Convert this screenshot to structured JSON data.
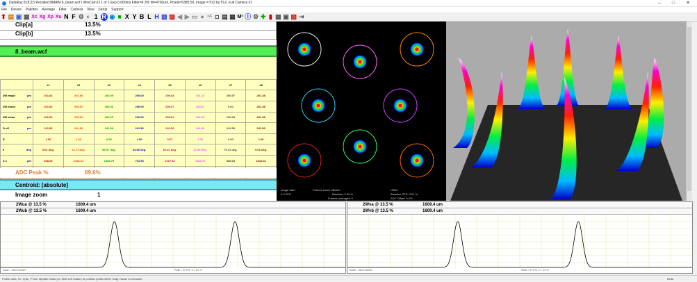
{
  "window": {
    "title": "DataRay 8.0C15 Recalled:8MAW-9_beam.wcf  |  WinCam D 1 of 1   Exp:0.000ms Filter=8.3%   W=4700um, Pixels=5385.50, image = 512 by 512, Full   Camera #1",
    "controls": [
      "–",
      "□",
      "✕"
    ]
  },
  "menu": [
    "File",
    "Device",
    "Palettes",
    "Average",
    "Filter",
    "Camera",
    "View",
    "Setup",
    "Support"
  ],
  "toolbar": {
    "icons": [
      "arrow-up-icon",
      "open-icon",
      "save-icon",
      "print-icon",
      "xc-icon",
      "xg-icon",
      "xp-icon",
      "xu-icon",
      "n-icon",
      "f-icon",
      "gear-icon",
      "zero-icon",
      "one-icon",
      "r-icon",
      "globe-icon",
      "record-icon",
      "x-icon",
      "y-icon",
      "b-icon",
      "l-icon",
      "h-icon",
      "grid-icon",
      "reverse-icon",
      "arrow-left-icon",
      "arrow-right-icon",
      "rect-icon",
      "cursor-icon",
      "ra-icon",
      "camera-icon",
      "printer-icon",
      "clipboard-icon",
      "m2-icon",
      "info-icon",
      "settings-icon",
      "plus-icon",
      "thermometer-icon",
      "table-icon",
      "layout-icon",
      "chart-icon",
      "export-icon"
    ],
    "labels": {
      "xc": "Xc",
      "xg": "Xg",
      "xp": "Xp",
      "xu": "Xu",
      "n": "N",
      "f": "F",
      "one": "1",
      "x": "X",
      "y": "Y",
      "b": "B",
      "l": "L",
      "h": "H",
      "ra": "rA",
      "m2": "M²"
    }
  },
  "left": {
    "clip_a": {
      "label": "Clip[a]",
      "value": "13.5%"
    },
    "clip_b": {
      "label": "Clip[b]",
      "value": "13.5%"
    },
    "file": "8_beam.wcf",
    "adc": {
      "label": "ADC Peak %",
      "value": "89.6%"
    },
    "centroid": "Centroid: [absolute]",
    "zoom": {
      "label": "Image zoom",
      "value": "1"
    }
  },
  "table": {
    "headers": [
      "#1",
      "#2",
      "#3",
      "#4",
      "#5",
      "#6",
      "#7",
      "#8"
    ],
    "rows": [
      {
        "label": "2W major",
        "unit": "µm",
        "values": [
          "201.64",
          "201.66",
          "203.09",
          "200.00",
          "200.84",
          "201.10",
          "200.97",
          "201.38"
        ]
      },
      {
        "label": "2W minor",
        "unit": "µm",
        "values": [
          "201.64",
          "200.57",
          "200.06",
          "200.00",
          "200.07",
          "200.07",
          "0.00",
          "201.38"
        ]
      },
      {
        "label": "2W mean",
        "unit": "µm",
        "values": [
          "201.64",
          "200.61",
          "202.25",
          "200.00",
          "200.81",
          "201.03",
          "100.28",
          "201.38"
        ]
      },
      {
        "label": "D eff",
        "unit": "µm",
        "values": [
          "241.56",
          "241.56",
          "241.58",
          "241.56",
          "241.56",
          "241.56",
          "241.59",
          "241.56"
        ]
      },
      {
        "label": "E",
        "unit": "",
        "values": [
          "1.00",
          "1.00",
          "0.99",
          "1.00",
          "0.97",
          "1.00",
          "0.00",
          "1.00"
        ]
      },
      {
        "label": "θ",
        "unit": "deg",
        "values": [
          "0.01 deg.",
          "11.71 deg.",
          "86.97 deg.",
          "34.66 deg.",
          "62.51 deg.",
          "21.50 deg.",
          "79.31 deg.",
          "0.01 deg."
        ]
      },
      {
        "label": "X c",
        "unit": "µm",
        "values": [
          "468.25",
          "2341.31",
          "1404.79",
          "701.93",
          "2107.63",
          "1404.79",
          "468.25",
          "2341.31"
        ]
      },
      {
        "label": "Y c",
        "unit": "µm",
        "values": [
          "468.25",
          "468.25",
          "701.93",
          "1404.78",
          "1404.78",
          "2107.63",
          "2341.31",
          "2341.31"
        ]
      },
      {
        "label": "Q m",
        "unit": "%",
        "values": [
          "-----",
          "-----",
          "-----",
          "-----",
          "-----",
          "-----",
          "-----",
          "-----"
        ]
      }
    ],
    "colors": [
      "#cc0000",
      "#ff3300",
      "#00a000",
      "#0000cc",
      "#cc0066",
      "#ff44ff",
      "#444444",
      "#880000"
    ]
  },
  "image_info": {
    "valid": "Image valid",
    "fps": "0.0 FPS",
    "frames_good": "Frames Good: 0Bad:0",
    "baseline": "Baseline: 0.00 %",
    "frames_averaged": "Frames averaged: 0",
    "usb": "USB2",
    "baseline_std": "Baseline STD: 0.01 %",
    "adc_offset": "ADC Offset: 0.0%"
  },
  "profiles": {
    "left": {
      "row1": {
        "label": "2Wua @ 13.5 %",
        "value": "1609.4 um"
      },
      "row2": {
        "label": "2Wub @ 13.5 %",
        "value": "1609.4 um"
      },
      "scale": "Scale = 400.0 um/div",
      "peak": "Peak = 97.6 %, 0 = 0.0 %",
      "peaks_x": [
        0.33,
        0.68
      ]
    },
    "right": {
      "row1": {
        "label": "2Wva @ 13.5 %",
        "value": "1609.4 um"
      },
      "row2": {
        "label": "2Wvb @ 13.5 %",
        "value": "1609.4 um"
      },
      "scale": "Scale = 400.0 um/div",
      "peak": "Peak = 97.6 %, 0 = 0.0 %",
      "peaks_x": [
        0.32,
        0.67
      ]
    }
  },
  "status": {
    "hint": "Profile area, To: 'Q'ds, 'P'oes. M(iddle button) or Shift Left button) to position profile NEW, Drag mouse to measure.",
    "mode": "NUM"
  },
  "colors": {
    "green_header": "#55ee55",
    "cyan_header": "#7fe5ef",
    "table_bg": "#ffffc0",
    "adc_text": "#e08030",
    "floor": "#262626"
  }
}
